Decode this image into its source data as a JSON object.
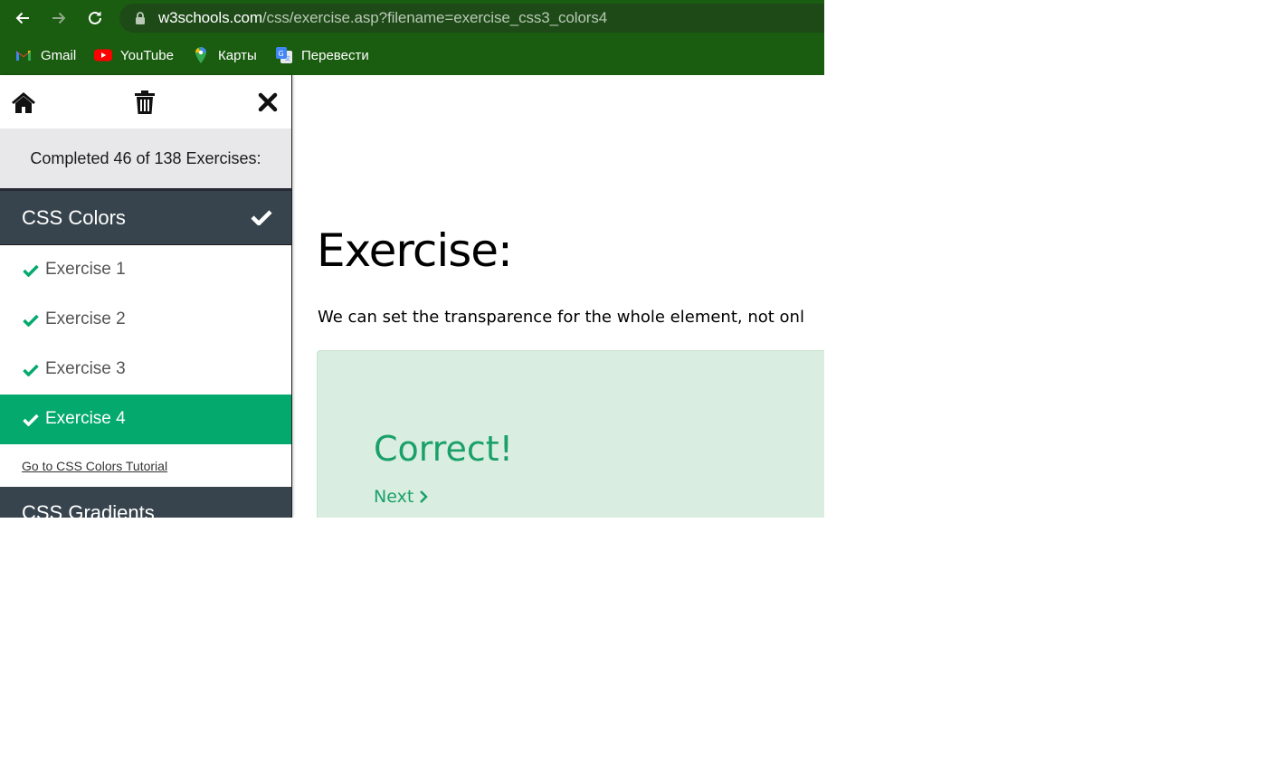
{
  "browser": {
    "url_host": "w3schools.com",
    "url_path": "/css/exercise.asp?filename=exercise_css3_colors4",
    "bookmarks": [
      {
        "label": "Gmail",
        "icon": "gmail-icon"
      },
      {
        "label": "YouTube",
        "icon": "youtube-icon"
      },
      {
        "label": "Карты",
        "icon": "maps-icon"
      },
      {
        "label": "Перевести",
        "icon": "translate-icon"
      }
    ]
  },
  "sidebar": {
    "progress_text": "Completed 46 of 138 Exercises:",
    "section_title": "CSS Colors",
    "exercises": [
      {
        "label": "Exercise 1",
        "done": true
      },
      {
        "label": "Exercise 2",
        "done": true
      },
      {
        "label": "Exercise 3",
        "done": true
      },
      {
        "label": "Exercise 4",
        "done": true,
        "active": true
      }
    ],
    "tutorial_link": "Go to CSS Colors Tutorial",
    "next_section_title": "CSS Gradients"
  },
  "main": {
    "heading": "Exercise:",
    "description": "We can set the transparence for the whole element, not onl",
    "result_title": "Correct!",
    "next_label": "Next"
  },
  "colors": {
    "chrome": "#1a5c10",
    "accent": "#04aa6d",
    "sidebar_dark": "#38444d"
  }
}
